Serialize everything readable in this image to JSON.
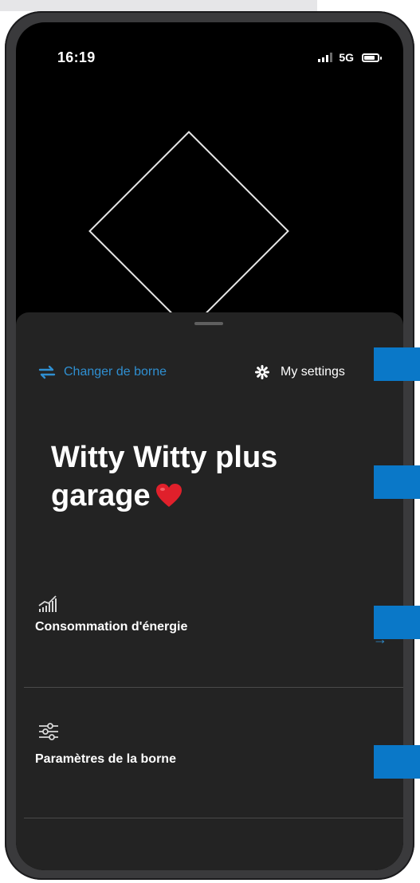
{
  "status_bar": {
    "time": "16:19",
    "network": "5G"
  },
  "sheet": {
    "change_station_label": "Changer de borne",
    "settings_label": "My settings",
    "station_title": "Witty Witty plus garage"
  },
  "menu": {
    "items": [
      {
        "label": "Consommation d'énergie",
        "icon": "energy-chart-icon"
      },
      {
        "label": "Paramètres de la borne",
        "icon": "sliders-icon"
      }
    ],
    "arrow": "→"
  },
  "colors": {
    "accent": "#2f8fd1",
    "sheet_background": "#232323",
    "overlay_tab": "#0a78c8"
  }
}
